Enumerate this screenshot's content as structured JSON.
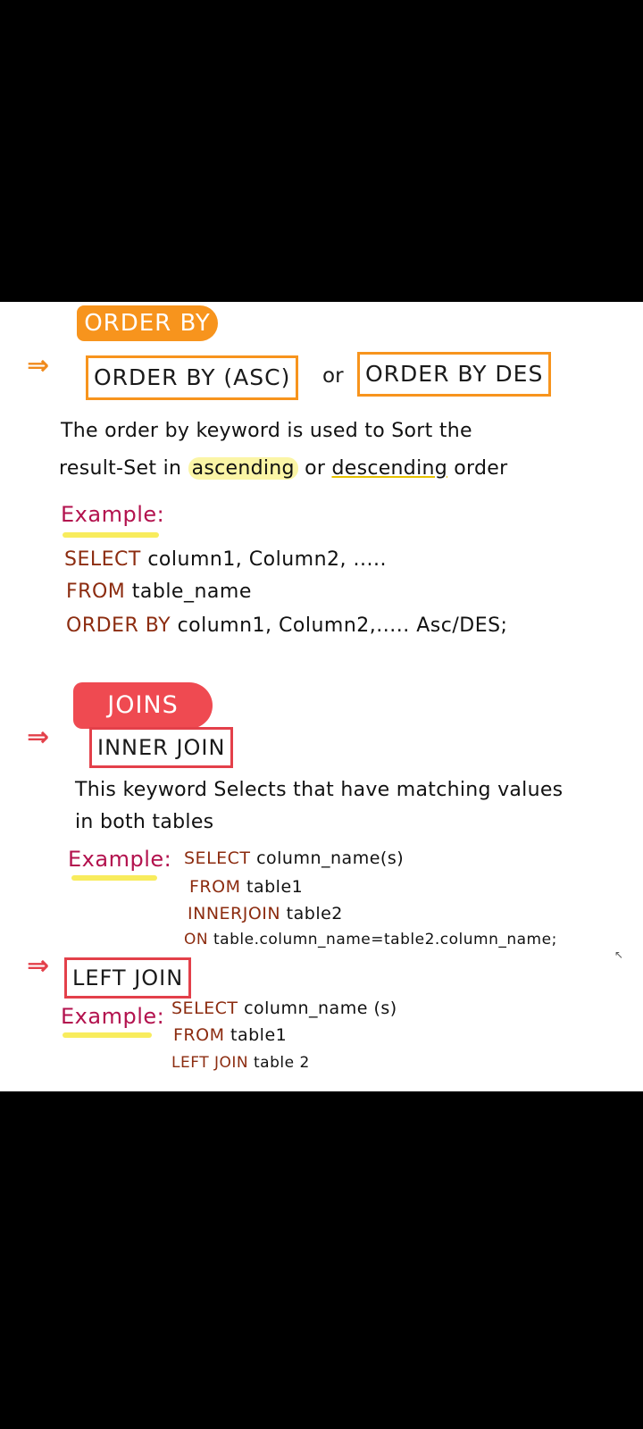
{
  "order_by": {
    "pill_label": "ORDER BY",
    "arrow": "⇒",
    "box1": "ORDER BY (ASC)",
    "or_word": "or",
    "box2": "ORDER BY DES",
    "description_line1": "The order by keyword is used to Sort the",
    "description_line2_start": "result-Set in",
    "description_ascending": "ascending",
    "description_or": "or",
    "description_descending": "descending",
    "description_order": "order",
    "example_label": "Example:",
    "code": [
      {
        "kw": "SELECT",
        "rest": "column1, Column2, ....."
      },
      {
        "kw": "FROM",
        "rest": "table_name"
      },
      {
        "kw": "ORDER BY",
        "rest": "column1, Column2,..... Asc/DES;"
      }
    ]
  },
  "joins": {
    "pill_label": "JOINS",
    "inner": {
      "arrow": "⇒",
      "box_label": "INNER JOIN",
      "description_line1": "This keyword Selects that have matching values",
      "description_line2": "in both tables",
      "example_label": "Example:",
      "code": [
        {
          "kw": "SELECT",
          "rest": "column_name(s)"
        },
        {
          "kw": "FROM",
          "rest": "table1"
        },
        {
          "kw": "INNERJOIN",
          "rest": "table2"
        },
        {
          "kw": "ON",
          "rest": "table.column_name=table2.column_name;"
        }
      ]
    },
    "left": {
      "arrow": "⇒",
      "box_label": "LEFT JOIN",
      "example_label": "Example:",
      "code": [
        {
          "kw": "SELECT",
          "rest": "column_name (s)"
        },
        {
          "kw": "FROM",
          "rest": "table1"
        },
        {
          "kw": "LEFT JOIN",
          "rest": "table 2"
        }
      ]
    }
  },
  "colors": {
    "orange": "#f7941d",
    "red": "#ef4a51",
    "example_magenta": "#b3124e",
    "highlight_yellow": "#fbf5a6",
    "code_keyword": "#8c2c10"
  }
}
